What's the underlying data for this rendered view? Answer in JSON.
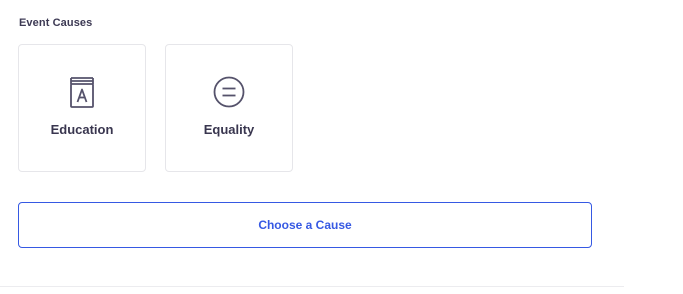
{
  "section": {
    "title": "Event Causes"
  },
  "causes": [
    {
      "label": "Education",
      "icon": "book-icon"
    },
    {
      "label": "Equality",
      "icon": "equals-circle-icon"
    }
  ],
  "choose_button": {
    "label": "Choose a Cause"
  },
  "colors": {
    "accent": "#3659e3",
    "text": "#39364f",
    "card_border": "#e6e6ea"
  }
}
